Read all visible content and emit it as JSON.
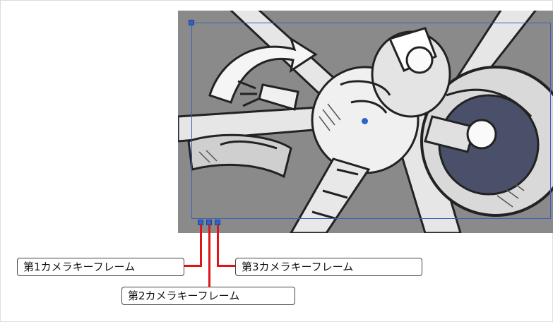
{
  "canvas": {
    "description_icon": "storyboard-sketch",
    "background_color": "#8a8a8a"
  },
  "keyframe_callouts": [
    {
      "label": "第1カメラキーフレーム"
    },
    {
      "label": "第2カメラキーフレーム"
    },
    {
      "label": "第3カメラキーフレーム"
    }
  ],
  "colors": {
    "camera_frame": "#3d5fb4",
    "handle": "#2f63c8",
    "leader_line": "#e01515"
  }
}
